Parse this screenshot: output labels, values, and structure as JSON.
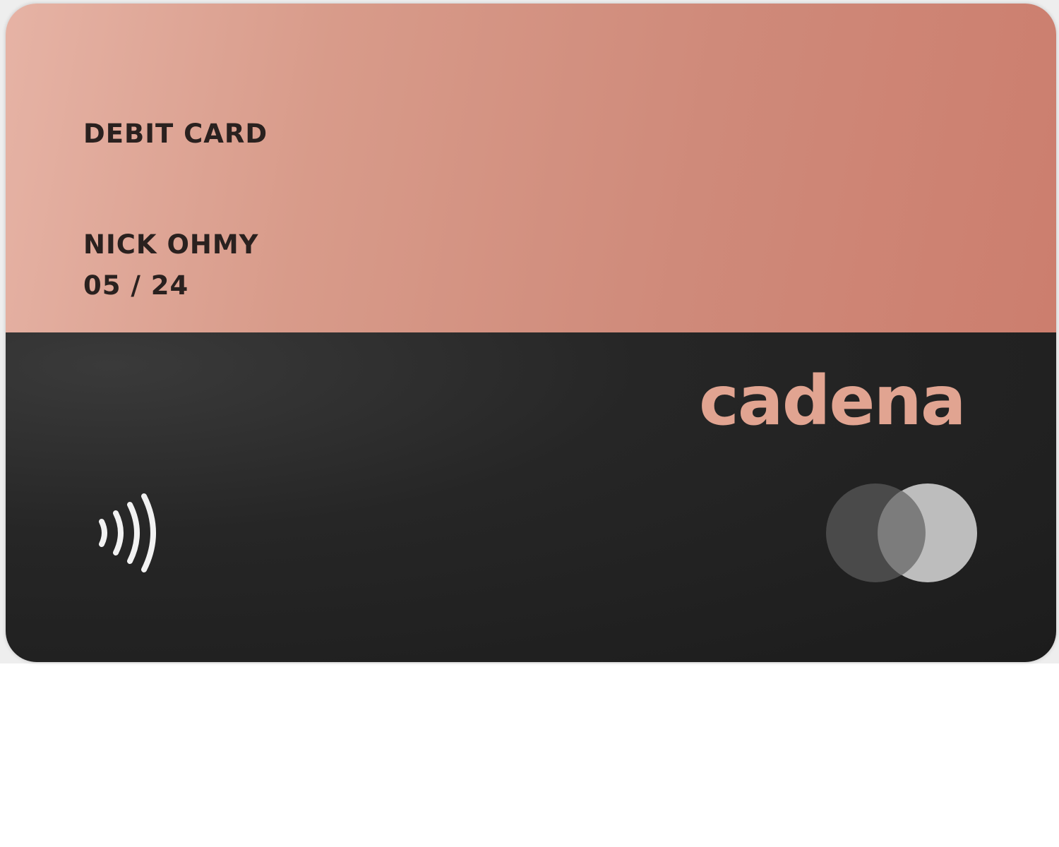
{
  "card": {
    "type_label": "DEBIT CARD",
    "holder_name": "NICK OHMY",
    "expiry": "05 / 24",
    "brand_name": "cadena",
    "icons": {
      "contactless": "contactless-icon",
      "network": "card-network-logo"
    },
    "colors": {
      "top_panel": "#d4927f",
      "bottom_panel": "#222222",
      "brand": "#e1a491",
      "text": "#2a211f"
    }
  }
}
